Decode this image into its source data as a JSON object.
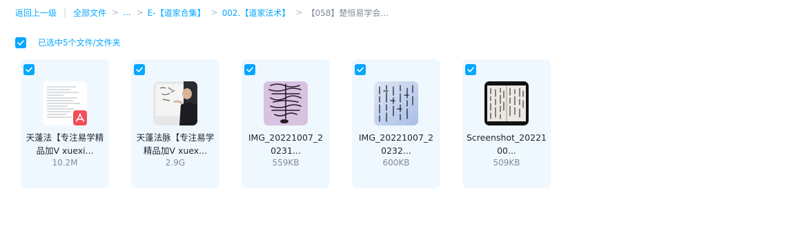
{
  "breadcrumb": {
    "back": "返回上一级",
    "all_files": "全部文件",
    "ellipsis": "...",
    "folder1": "E-【道家合集】",
    "folder2": "002.【道家法术】",
    "current": "【058】楚恒易学会...",
    "separator": ">",
    "divider": "|"
  },
  "selection": {
    "label": "已选中5个文件/文件夹"
  },
  "files": [
    {
      "name": "天蓬法【专注易学精品加V xuexi...",
      "size": "10.2M",
      "icon": "pdf-document"
    },
    {
      "name": "天蓬法脉【专注易学精品加V xuex...",
      "size": "2.9G",
      "icon": "video-thumbnail"
    },
    {
      "name": "IMG_20221007_20231...",
      "size": "559KB",
      "icon": "image-talisman-purple"
    },
    {
      "name": "IMG_20221007_20232...",
      "size": "600KB",
      "icon": "image-talisman-blue"
    },
    {
      "name": "Screenshot_2022100...",
      "size": "509KB",
      "icon": "image-screenshot"
    }
  ],
  "colors": {
    "accent": "#06a7ff",
    "card_bg": "#eff8fe",
    "pdf_red": "#ef4f5b"
  }
}
